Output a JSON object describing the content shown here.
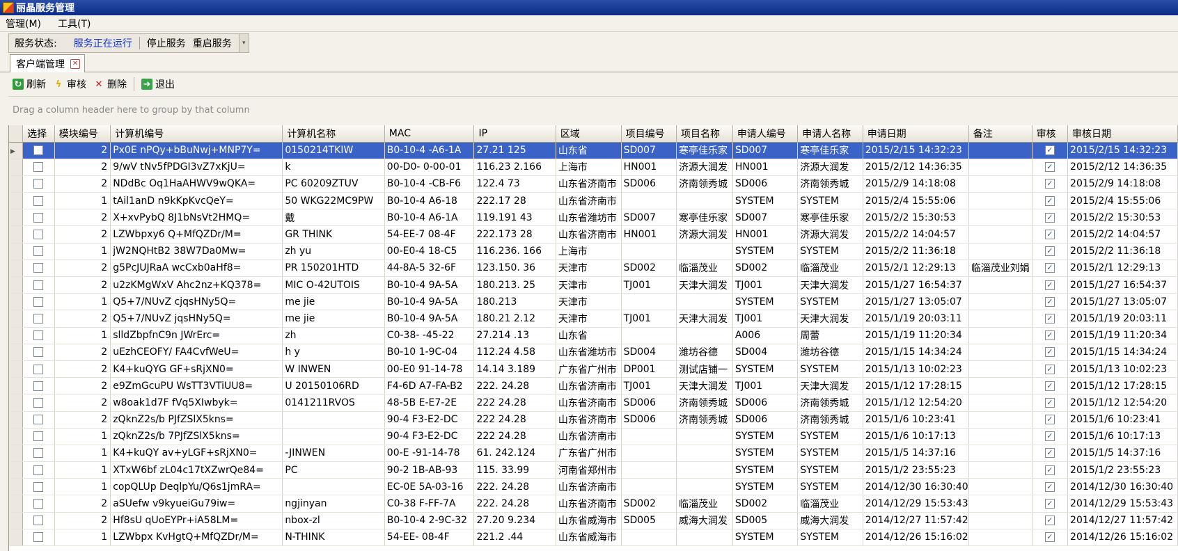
{
  "window": {
    "title": "丽晶服务管理"
  },
  "menu": [
    "管理(M)",
    "工具(T)"
  ],
  "service": {
    "status_label": "服务状态:",
    "status_value": "服务正在运行",
    "stop_label": "停止服务",
    "restart_label": "重启服务"
  },
  "tab": {
    "label": "客户端管理"
  },
  "toolbar": {
    "refresh": "刷新",
    "audit": "审核",
    "delete": "删除",
    "exit": "退出"
  },
  "group_hint": "Drag a column header here to group by that column",
  "columns": [
    "选择",
    "模块编号",
    "计算机编号",
    "计算机名称",
    "MAC",
    "IP",
    "区域",
    "项目编号",
    "项目名称",
    "申请人编号",
    "申请人名称",
    "申请日期",
    "备注",
    "审核",
    "审核日期"
  ],
  "rows": [
    [
      "",
      "2",
      "Px0E     nPQy+bBuNwj+MNP7Y=",
      "    0150214TKIW",
      "B0-10-4     -A6-1A",
      "27.21      125",
      "山东省",
      "SD007",
      "寒亭佳乐家",
      "SD007",
      "寒亭佳乐家",
      "2015/2/15 14:32:23",
      "",
      "1",
      "2015/2/15 14:32:23"
    ],
    [
      "",
      "2",
      "9/wV      tNv5fPDGI3vZ7xKjU=",
      "k",
      "00-D0-     0-00-01",
      "116.23      2.166",
      "上海市",
      "HN001",
      "济源大润发",
      "HN001",
      "济源大润发",
      "2015/2/12 14:36:35",
      "",
      "1",
      "2015/2/12 14:36:35"
    ],
    [
      "",
      "2",
      "NDdBc      Oq1HaAHWV9wQKA=",
      "PC     60209ZTUV",
      "B0-10-4     -CB-F6",
      "122.4     73",
      "山东省济南市",
      "SD006",
      "济南领秀城",
      "SD006",
      "济南领秀城",
      "2015/2/9 14:18:08",
      "",
      "1",
      "2015/2/9 14:18:08"
    ],
    [
      "",
      "1",
      "tAil1anD      n9kKpKvcQeY=",
      "50     WKG22MC9PW",
      "B0-10-4     A6-18",
      "222.17     28",
      "山东省济南市",
      "",
      "",
      "SYSTEM",
      "SYSTEM",
      "2015/2/4 15:55:06",
      "",
      "1",
      "2015/2/4 15:55:06"
    ],
    [
      "",
      "2",
      "X+xvPybQ      8J1bNsVt2HMQ=",
      "戴",
      "B0-10-4     A6-1A",
      "119.191      43",
      "山东省潍坊市",
      "SD007",
      "寒亭佳乐家",
      "SD007",
      "寒亭佳乐家",
      "2015/2/2 15:30:53",
      "",
      "1",
      "2015/2/2 15:30:53"
    ],
    [
      "",
      "2",
      "LZWbpxy6      Q+MfQZDr/M=",
      "GR     THINK",
      "54-EE-7     08-4F",
      "222.173     28",
      "山东省济南市",
      "HN001",
      "济源大润发",
      "HN001",
      "济源大润发",
      "2015/2/2 14:04:57",
      "",
      "1",
      "2015/2/2 14:04:57"
    ],
    [
      "",
      "1",
      "jW2NQHtB2      38W7Da0Mw=",
      "zh     yu",
      "00-E0-4     18-C5",
      "116.236.     166",
      "上海市",
      "",
      "",
      "SYSTEM",
      "SYSTEM",
      "2015/2/2 11:36:18",
      "",
      "1",
      "2015/2/2 11:36:18"
    ],
    [
      "",
      "2",
      "g5PcJUJRaA      wcCxb0aHf8=",
      "PR     150201HTD",
      "44-8A-5     32-6F",
      "123.150.     36",
      "天津市",
      "SD002",
      "临淄茂业",
      "SD002",
      "临淄茂业",
      "2015/2/1 12:29:13",
      "临淄茂业刘娟",
      "1",
      "2015/2/1 12:29:13"
    ],
    [
      "",
      "2",
      "u2zKMgWxV      Ahc2nz+KQ378=",
      "MIC     O-42UTOIS",
      "B0-10-4     9A-5A",
      "180.213.     25",
      "天津市",
      "TJ001",
      "天津大润发",
      "TJ001",
      "天津大润发",
      "2015/1/27 16:54:37",
      "",
      "1",
      "2015/1/27 16:54:37"
    ],
    [
      "",
      "1",
      "Q5+7/NUvZ      cjqsHNy5Q=",
      "me     jie",
      "B0-10-4     9A-5A",
      "180.213     ",
      "天津市",
      "",
      "",
      "SYSTEM",
      "SYSTEM",
      "2015/1/27 13:05:07",
      "",
      "1",
      "2015/1/27 13:05:07"
    ],
    [
      "",
      "2",
      "Q5+7/NUvZ      jqsHNy5Q=",
      "me     jie",
      "B0-10-4     9A-5A",
      "180.21     2.12",
      "天津市",
      "TJ001",
      "天津大润发",
      "TJ001",
      "天津大润发",
      "2015/1/19 20:03:11",
      "",
      "1",
      "2015/1/19 20:03:11"
    ],
    [
      "",
      "1",
      "slldZbpfnC9n      JWrErc=",
      "zh",
      "C0-38-     -45-22",
      "27.214     .13",
      "山东省",
      "",
      "",
      "A006",
      "周蕾",
      "2015/1/19 11:20:34",
      "",
      "1",
      "2015/1/19 11:20:34"
    ],
    [
      "",
      "2",
      "uEzhCEOFY/      FA4CvfWeU=",
      "h     y",
      "B0-10     1-9C-04",
      "112.24     4.58",
      "山东省潍坊市",
      "SD004",
      "潍坊谷德",
      "SD004",
      "潍坊谷德",
      "2015/1/15 14:34:24",
      "",
      "1",
      "2015/1/15 14:34:24"
    ],
    [
      "",
      "2",
      "K4+kuQYG      GF+sRjXN0=",
      "W     INWEN",
      "00-E0     91-14-78",
      "14.14     3.189",
      "广东省广州市",
      "DP001",
      "测试店铺一",
      "SYSTEM",
      "SYSTEM",
      "2015/1/13 10:02:23",
      "",
      "1",
      "2015/1/13 10:02:23"
    ],
    [
      "",
      "2",
      "e9ZmGcuPU      WsTT3VTiUU8=",
      "U     20150106RD",
      "F4-6D     A7-FA-B2",
      "222.     24.28",
      "山东省济南市",
      "TJ001",
      "天津大润发",
      "TJ001",
      "天津大润发",
      "2015/1/12 17:28:15",
      "",
      "1",
      "2015/1/12 17:28:15"
    ],
    [
      "",
      "2",
      "w8oak1d7F      fVq5XIwbyk=",
      "     0141211RVOS",
      "48-5B     E-E7-2E",
      "222     24.28",
      "山东省济南市",
      "SD006",
      "济南领秀城",
      "SD006",
      "济南领秀城",
      "2015/1/12 12:54:20",
      "",
      "1",
      "2015/1/12 12:54:20"
    ],
    [
      "",
      "2",
      "zQknZ2s/b      PJfZSlX5kns=",
      "",
      "90-4     F3-E2-DC",
      "222     24.28",
      "山东省济南市",
      "SD006",
      "济南领秀城",
      "SD006",
      "济南领秀城",
      "2015/1/6 10:23:41",
      "",
      "1",
      "2015/1/6 10:23:41"
    ],
    [
      "",
      "1",
      "zQknZ2s/b      7PJfZSlX5kns=",
      "",
      "90-4     F3-E2-DC",
      "222     24.28",
      "山东省济南市",
      "",
      "",
      "SYSTEM",
      "SYSTEM",
      "2015/1/6 10:17:13",
      "",
      "1",
      "2015/1/6 10:17:13"
    ],
    [
      "",
      "1",
      "K4+kuQY      av+yLGF+sRjXN0=",
      "     -JINWEN",
      "00-E     -91-14-78",
      "61.     242.124",
      "广东省广州市",
      "",
      "",
      "SYSTEM",
      "SYSTEM",
      "2015/1/5 14:37:16",
      "",
      "1",
      "2015/1/5 14:37:16"
    ],
    [
      "",
      "1",
      "XTxW6bf      zL04c17tXZwrQe84=",
      "     PC",
      "90-2     1B-AB-93",
      "115.     33.99",
      "河南省郑州市",
      "",
      "",
      "SYSTEM",
      "SYSTEM",
      "2015/1/2 23:55:23",
      "",
      "1",
      "2015/1/2 23:55:23"
    ],
    [
      "",
      "1",
      "copQLUp      DeqlpYu/Q6s1jmRA=",
      "",
      "EC-0E     5A-03-16",
      "222.     24.28",
      "山东省济南市",
      "",
      "",
      "SYSTEM",
      "SYSTEM",
      "2014/12/30 16:30:40",
      "",
      "1",
      "2014/12/30 16:30:40"
    ],
    [
      "",
      "2",
      "aSUefw      v9kyueiGu79iw=",
      "     ngjinyan",
      "C0-38     F-FF-7A",
      "222.     24.28",
      "山东省济南市",
      "SD002",
      "临淄茂业",
      "SD002",
      "临淄茂业",
      "2014/12/29 15:53:43",
      "",
      "1",
      "2014/12/29 15:53:43"
    ],
    [
      "",
      "2",
      "Hf8sU      qUoEYPr+iA58LM=",
      "     nbox-zl",
      "B0-10-4     2-9C-32",
      "27.20     9.234",
      "山东省威海市",
      "SD005",
      "威海大润发",
      "SD005",
      "威海大润发",
      "2014/12/27 11:57:42",
      "",
      "1",
      "2014/12/27 11:57:42"
    ],
    [
      "",
      "1",
      "LZWbpx      KvHgtQ+MfQZDr/M=",
      "     N-THINK",
      "54-EE-     08-4F",
      "221.2     .44",
      "山东省威海市",
      "",
      "",
      "SYSTEM",
      "SYSTEM",
      "2014/12/26 15:16:02",
      "",
      "1",
      "2014/12/26 15:16:02"
    ]
  ],
  "selected_row": 0
}
